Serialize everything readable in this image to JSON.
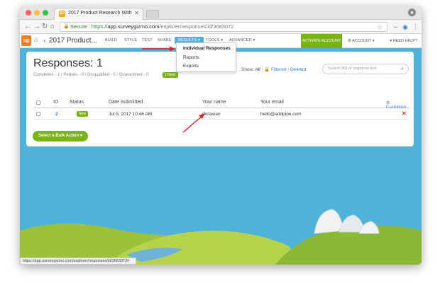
{
  "browser": {
    "tab_title": "2017 Product Research With",
    "tab_favicon_text": "SG",
    "url_secure_label": "Secure",
    "url_scheme": "https://",
    "url_host": "app.surveygizmo.com",
    "url_path": "/explorer/responses/id/3683072",
    "status_url": "https://app.surveygizmo.com/explorer/responses/id/3683072#"
  },
  "app": {
    "logo_text": "sg",
    "survey_title": "2017 Product...",
    "nav": [
      "BUILD",
      "STYLE",
      "TEST",
      "SHARE",
      "RESULTS ▾",
      "TOOLS ▾",
      "ADVANCED ▾"
    ],
    "activate_label": "ACTIVATE ACCOUNT",
    "account_label": "⚙ ACCOUNT ▾",
    "help_label": "♥ NEED HELP?"
  },
  "results_menu": {
    "items": [
      "Individual Responses",
      "Reports",
      "Exports"
    ]
  },
  "responses": {
    "title": "Responses: 1",
    "summary": "Completes - 1 / Partials - 0 / Disqualified - 0 / Quarantined - 0",
    "new_badge": "1 New!",
    "show_label": "Show:",
    "show_all": "All",
    "show_filtered": "Filtered",
    "show_deleted": "Deleted",
    "search_placeholder": "Search #ID or response text",
    "columns": [
      "ID",
      "Status",
      "Date Submitted",
      "Your name",
      "Your email"
    ],
    "customize_label": "Customize",
    "rows": [
      {
        "id": "2",
        "status": "New",
        "date": "Jul 5, 2017 10:46 AM",
        "name": "Octavian",
        "email": "hello@addpipe.com"
      }
    ],
    "bulk_action_label": "Select a Bulk Action ▾"
  },
  "colors": {
    "accent_blue": "#4fb3d9",
    "brand_green": "#7ab317",
    "brand_orange": "#f07f2a",
    "arrow_red": "#e02020"
  }
}
